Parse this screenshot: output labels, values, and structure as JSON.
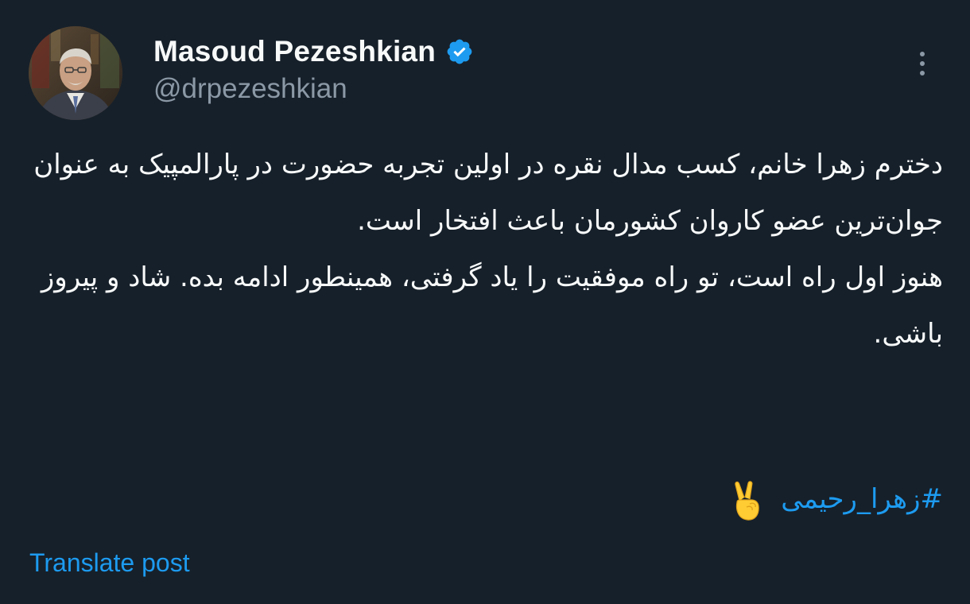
{
  "author": {
    "display_name": "Masoud Pezeshkian",
    "handle": "@drpezeshkian",
    "verified": true,
    "verified_badge_color": "#1d9bf0"
  },
  "post": {
    "paragraph_1": "دخترم زهرا خانم، کسب مدال نقره در اولین تجربه حضورت در پارالمپیک به عنوان جوان‌ترین عضو کاروان کشورمان باعث افتخار است.",
    "paragraph_2": "هنوز اول راه است، تو راه موفقیت را یاد گرفتی، همینطور ادامه بده. شاد و پیروز باشی.",
    "hashtag": "#زهرا_رحیمی",
    "emoji": "victory-hand"
  },
  "actions": {
    "translate_label": "Translate post",
    "more_icon": "more-vertical-icon"
  },
  "theme": {
    "background": "#16202a",
    "primary_text": "#f7f9f9",
    "secondary_text": "#8b98a5",
    "link": "#1d9bf0"
  }
}
